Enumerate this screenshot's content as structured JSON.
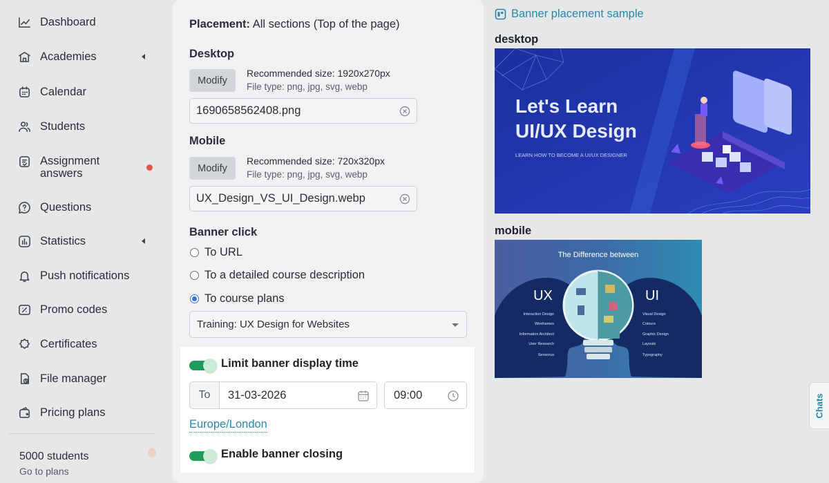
{
  "sidebar": {
    "items": [
      {
        "label": "Dashboard",
        "icon": "chart-line-icon"
      },
      {
        "label": "Academies",
        "icon": "school-building-icon"
      },
      {
        "label": "Calendar",
        "icon": "calendar-icon"
      },
      {
        "label": "Students",
        "icon": "users-icon"
      },
      {
        "label": "Assignment answers",
        "icon": "assignment-icon"
      },
      {
        "label": "Questions",
        "icon": "question-icon"
      },
      {
        "label": "Statistics",
        "icon": "statistics-icon"
      },
      {
        "label": "Push notifications",
        "icon": "bell-icon"
      },
      {
        "label": "Promo codes",
        "icon": "ticket-icon"
      },
      {
        "label": "Certificates",
        "icon": "certificate-icon"
      },
      {
        "label": "File manager",
        "icon": "file-icon"
      },
      {
        "label": "Pricing plans",
        "icon": "wallet-icon"
      }
    ],
    "plan": {
      "count": "5000 students",
      "link": "Go to plans"
    }
  },
  "form": {
    "placement_label": "Placement:",
    "placement_value": "All sections (Top of the page)",
    "desktop": {
      "title": "Desktop",
      "modify": "Modify",
      "recommended": "Recommended size: 1920x270px",
      "file_types": "File type: png, jpg, svg, webp",
      "file_name": "1690658562408.png"
    },
    "mobile": {
      "title": "Mobile",
      "modify": "Modify",
      "recommended": "Recommended size: 720x320px",
      "file_types": "File type: png, jpg, svg, webp",
      "file_name": "UX_Design_VS_UI_Design.webp"
    },
    "banner_click": {
      "title": "Banner click",
      "options": [
        "To URL",
        "To a detailed course description",
        "To course plans"
      ],
      "selected": 2,
      "course_select": "Training: UX Design for Websites"
    },
    "limit_display": {
      "label": "Limit banner display time",
      "enabled": true,
      "to_prefix": "To",
      "date": "31-03-2026",
      "time": "09:00",
      "timezone": "Europe/London"
    },
    "enable_closing": {
      "label": "Enable banner closing",
      "enabled": true
    }
  },
  "preview": {
    "sample_link": "Banner placement sample",
    "desktop_label": "desktop",
    "mobile_label": "mobile",
    "desktop_banner": {
      "headline_1": "Let's Learn",
      "headline_2": "UI/UX Design",
      "subline": "LEARN HOW TO BECOME A UI/UX DESIGNER"
    },
    "mobile_banner": {
      "title": "The Difference between",
      "left": "UX",
      "right": "UI",
      "left_items": [
        "Interaction Design",
        "Wireframes",
        "Information Architect",
        "User Research",
        "Sensorus"
      ],
      "right_items": [
        "Visual Design",
        "Colours",
        "Graphic Design",
        "Layouts",
        "Typography"
      ]
    }
  },
  "chats_tab": "Chats",
  "colors": {
    "accent": "#2a87a9",
    "toggle_on": "#1e9c5c",
    "notification_dot": "#e0534a",
    "radio_selected": "#3b6fd8"
  }
}
